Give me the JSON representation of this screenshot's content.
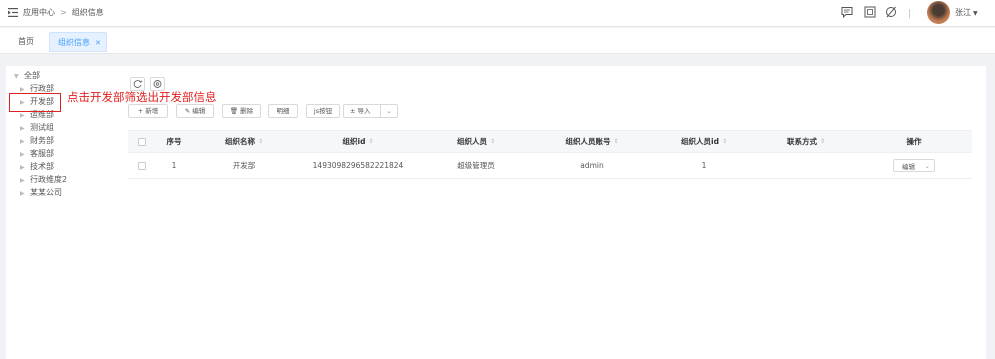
{
  "header": {
    "breadcrumb": [
      "应用中心",
      "组织信息"
    ],
    "user_name": "张江"
  },
  "tabs": [
    {
      "label": "首页",
      "active": false
    },
    {
      "label": "组织信息",
      "active": true
    }
  ],
  "tree": {
    "root": "全部",
    "items": [
      "行政部",
      "开发部",
      "运维部",
      "测试组",
      "财务部",
      "客服部",
      "技术部",
      "行政维度2",
      "某某公司"
    ]
  },
  "annotation": "点击开发部筛选出开发部信息",
  "toolbar": {
    "buttons": [
      "+ 新增",
      "编辑",
      "删除",
      "明细",
      "js按钮",
      "导入"
    ]
  },
  "table": {
    "columns": [
      "序号",
      "组织名称",
      "组织id",
      "组织人员",
      "组织人员账号",
      "组织人员id",
      "联系方式",
      "操作"
    ],
    "rows": [
      {
        "index": "1",
        "name": "开发部",
        "id": "1493098296582221824",
        "member": "超级管理员",
        "account": "admin",
        "member_id": "1",
        "contact": "",
        "action": "编辑"
      }
    ]
  },
  "colors": {
    "accent": "#409eff",
    "annotation": "#e02020",
    "tab_active_bg": "#e6f1ff"
  },
  "icons": [
    "menu-fold-icon",
    "message-icon",
    "fullscreen-icon",
    "theme-icon",
    "refresh-icon",
    "settings-icon",
    "edit-icon",
    "delete-icon",
    "upload-icon",
    "chevron-down-icon"
  ]
}
